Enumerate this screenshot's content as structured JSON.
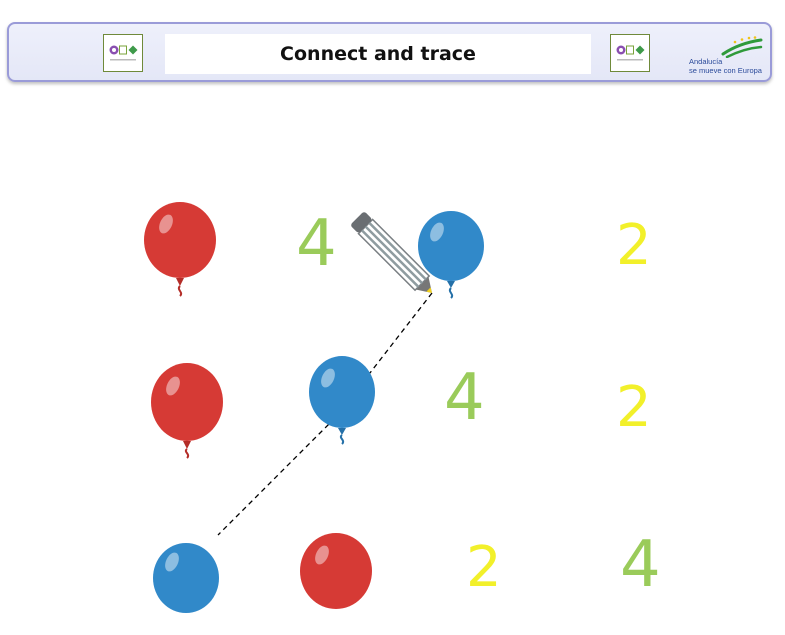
{
  "header": {
    "title": "Connect and trace",
    "logo_left_text": "O L A",
    "logo_right_text": "O L A",
    "brand_line1": "Andalucía",
    "brand_line2": "se mueve con Europa"
  },
  "colors": {
    "balloon_red": "#d63a35",
    "balloon_blue": "#3189c9",
    "number_green": "#9acb5a",
    "number_yellow": "#f2f02a",
    "header_border": "#9a9bd8"
  },
  "grid": {
    "row1": [
      {
        "kind": "balloon",
        "color": "red"
      },
      {
        "kind": "number",
        "value": "4",
        "color": "green"
      },
      {
        "kind": "balloon",
        "color": "blue"
      },
      {
        "kind": "number",
        "value": "2",
        "color": "yellow"
      }
    ],
    "row2": [
      {
        "kind": "balloon",
        "color": "red"
      },
      {
        "kind": "balloon",
        "color": "blue"
      },
      {
        "kind": "number",
        "value": "4",
        "color": "green"
      },
      {
        "kind": "number",
        "value": "2",
        "color": "yellow"
      }
    ],
    "row3": [
      {
        "kind": "balloon",
        "color": "blue"
      },
      {
        "kind": "balloon",
        "color": "red"
      },
      {
        "kind": "number",
        "value": "2",
        "color": "yellow"
      },
      {
        "kind": "number",
        "value": "4",
        "color": "green"
      }
    ]
  },
  "icons": [
    "pencil-icon",
    "balloon-icon",
    "ola-logo",
    "andalucia-brand-logo"
  ]
}
